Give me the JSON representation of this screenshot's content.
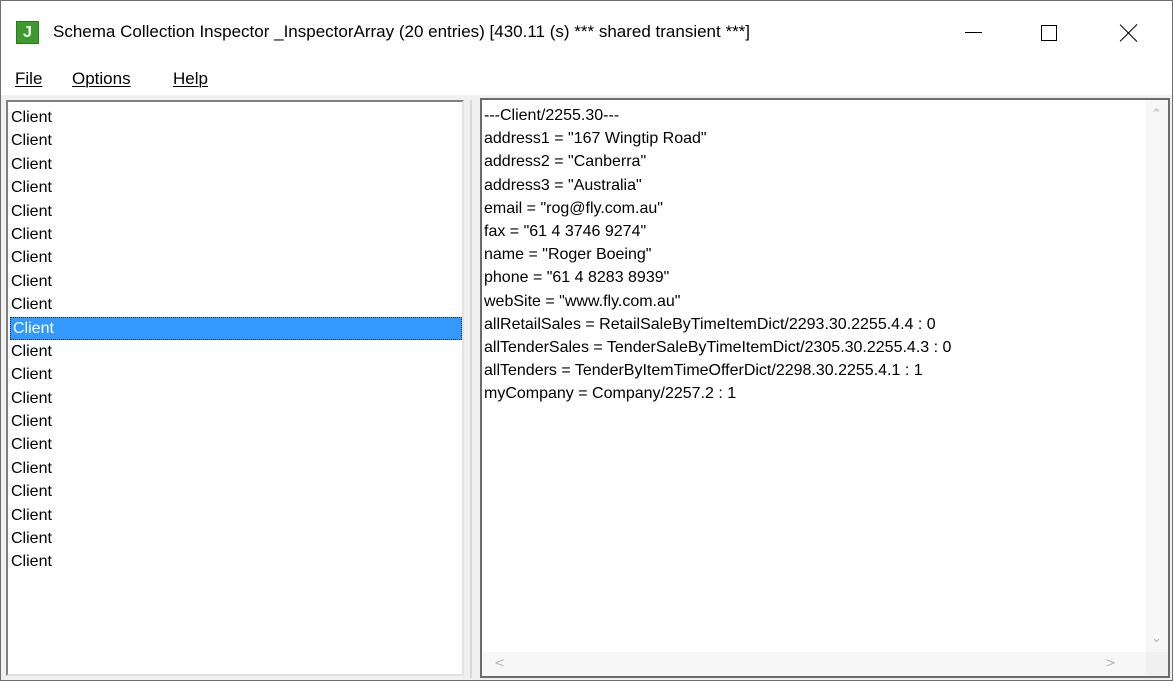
{
  "window": {
    "title": "Schema Collection Inspector _InspectorArray (20 entries) [430.11 (s) *** shared transient ***]",
    "icon_letter": "J",
    "icon_color": "#3c9b2c"
  },
  "menu": {
    "file": "File",
    "options": "Options",
    "help": "Help"
  },
  "list": {
    "items": [
      "Client",
      "Client",
      "Client",
      "Client",
      "Client",
      "Client",
      "Client",
      "Client",
      "Client",
      "Client",
      "Client",
      "Client",
      "Client",
      "Client",
      "Client",
      "Client",
      "Client",
      "Client",
      "Client",
      "Client"
    ],
    "selected_index": 9,
    "selection_color": "#3399ff"
  },
  "details": {
    "lines": [
      "---Client/2255.30---",
      "address1 = \"167 Wingtip Road\"",
      "address2 = \"Canberra\"",
      "address3 = \"Australia\"",
      "email = \"rog@fly.com.au\"",
      "fax = \"61 4 3746 9274\"",
      "name = \"Roger Boeing\"",
      "phone = \"61 4 8283 8939\"",
      "webSite = \"www.fly.com.au\"",
      "allRetailSales = RetailSaleByTimeItemDict/2293.30.2255.4.4 : 0",
      "allTenderSales = TenderSaleByTimeItemDict/2305.30.2255.4.3 : 0",
      "allTenders = TenderByItemTimeOfferDict/2298.30.2255.4.1 : 1",
      "myCompany = Company/2257.2 : 1"
    ]
  },
  "icons": {
    "app": "app-j-icon",
    "minimize": "minimize-icon",
    "maximize": "maximize-icon",
    "close": "close-icon",
    "scroll_up": "chevron-up-icon",
    "scroll_down": "chevron-down-icon",
    "scroll_left": "chevron-left-icon",
    "scroll_right": "chevron-right-icon"
  }
}
